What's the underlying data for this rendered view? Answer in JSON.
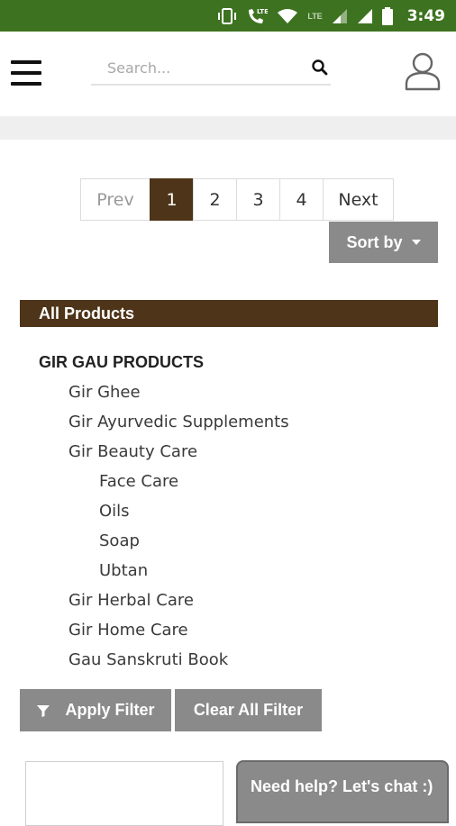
{
  "status_bar": {
    "time": "3:49",
    "network_label": "LTE"
  },
  "header": {
    "search_placeholder": "Search..."
  },
  "pagination": {
    "prev": "Prev",
    "pages": [
      "1",
      "2",
      "3",
      "4"
    ],
    "active_page": "1",
    "next": "Next"
  },
  "sort": {
    "label": "Sort by"
  },
  "categories": {
    "header": "All Products",
    "top": "GIR GAU PRODUCTS",
    "items": [
      "Gir Ghee",
      "Gir Ayurvedic Supplements",
      "Gir Beauty Care",
      "Face Care",
      "Oils",
      "Soap",
      "Ubtan",
      "Gir Herbal Care",
      "Gir Home Care",
      "Gau Sanskruti Book"
    ]
  },
  "filters": {
    "apply": "Apply Filter",
    "clear": "Clear All Filter"
  },
  "chat": {
    "label": "Need help? Let's chat :)"
  },
  "colors": {
    "status_bar": "#3d7320",
    "brand_brown": "#4e3418",
    "button_grey": "#8a8a8a"
  }
}
